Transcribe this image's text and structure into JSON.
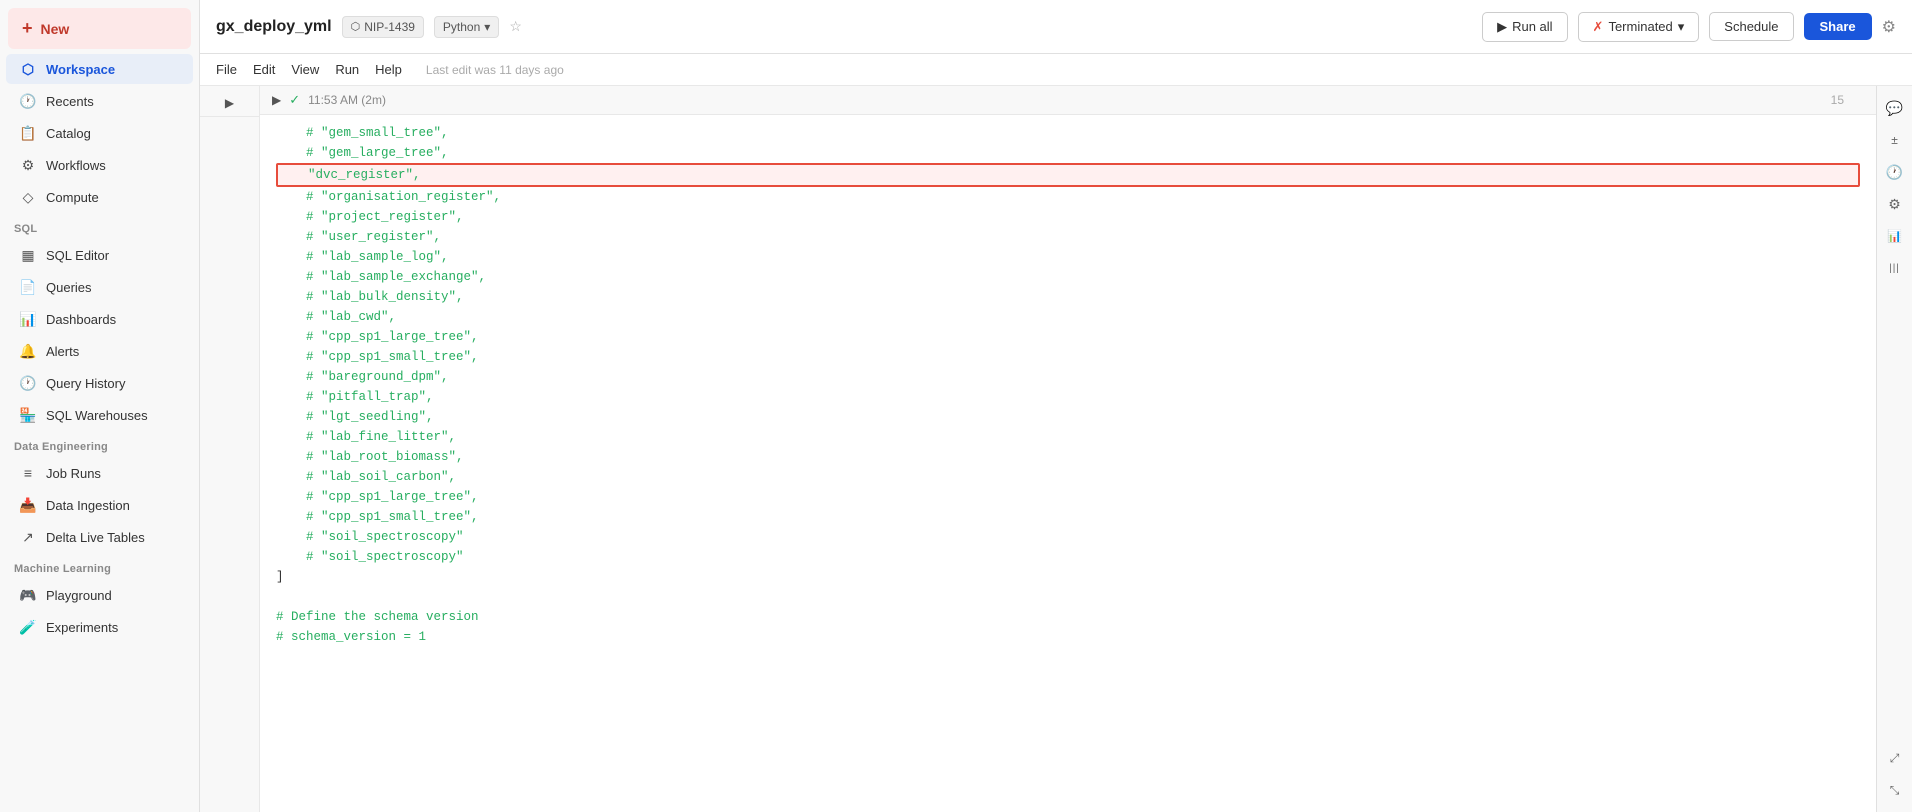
{
  "sidebar": {
    "new_label": "New",
    "items": [
      {
        "id": "workspace",
        "label": "Workspace",
        "icon": "🏠",
        "active": true,
        "section": null
      },
      {
        "id": "recents",
        "label": "Recents",
        "icon": "🕐",
        "active": false,
        "section": null
      },
      {
        "id": "catalog",
        "label": "Catalog",
        "icon": "📋",
        "active": false,
        "section": null
      },
      {
        "id": "workflows",
        "label": "Workflows",
        "icon": "⚙",
        "active": false,
        "section": null
      },
      {
        "id": "compute",
        "label": "Compute",
        "icon": "◇",
        "active": false,
        "section": null
      }
    ],
    "sql_section": "SQL",
    "sql_items": [
      {
        "id": "sql-editor",
        "label": "SQL Editor",
        "icon": "📝"
      },
      {
        "id": "queries",
        "label": "Queries",
        "icon": "📄"
      },
      {
        "id": "dashboards",
        "label": "Dashboards",
        "icon": "📊"
      },
      {
        "id": "alerts",
        "label": "Alerts",
        "icon": "🔔"
      },
      {
        "id": "query-history",
        "label": "Query History",
        "icon": "🕐"
      },
      {
        "id": "sql-warehouses",
        "label": "SQL Warehouses",
        "icon": "🏪"
      }
    ],
    "data_eng_section": "Data Engineering",
    "data_eng_items": [
      {
        "id": "job-runs",
        "label": "Job Runs",
        "icon": "≡"
      },
      {
        "id": "data-ingestion",
        "label": "Data Ingestion",
        "icon": "📥"
      },
      {
        "id": "delta-live-tables",
        "label": "Delta Live Tables",
        "icon": "↗"
      }
    ],
    "ml_section": "Machine Learning",
    "ml_items": [
      {
        "id": "playground",
        "label": "Playground",
        "icon": "🎮"
      },
      {
        "id": "experiments",
        "label": "Experiments",
        "icon": "🧪"
      }
    ]
  },
  "header": {
    "title": "gx_deploy_yml",
    "cluster": "NIP-1439",
    "language": "Python",
    "star_icon": "☆",
    "run_all_label": "Run all",
    "terminated_label": "Terminated",
    "schedule_label": "Schedule",
    "share_label": "Share"
  },
  "menubar": {
    "items": [
      "File",
      "Edit",
      "View",
      "Run",
      "Help"
    ],
    "last_edit": "Last edit was 11 days ago"
  },
  "cell": {
    "timestamp": "11:53 AM (2m)",
    "line_number": "15"
  },
  "code_lines": [
    {
      "text": "    # \"gem_small_tree\",",
      "highlighted": false
    },
    {
      "text": "    # \"gem_large_tree\",",
      "highlighted": false
    },
    {
      "text": "    \"dvc_register\",",
      "highlighted": true
    },
    {
      "text": "    # \"organisation_register\",",
      "highlighted": false
    },
    {
      "text": "    # \"project_register\",",
      "highlighted": false
    },
    {
      "text": "    # \"user_register\",",
      "highlighted": false
    },
    {
      "text": "    # \"lab_sample_log\",",
      "highlighted": false
    },
    {
      "text": "    # \"lab_sample_exchange\",",
      "highlighted": false
    },
    {
      "text": "    # \"lab_bulk_density\",",
      "highlighted": false
    },
    {
      "text": "    # \"lab_cwd\",",
      "highlighted": false
    },
    {
      "text": "    # \"cpp_sp1_large_tree\",",
      "highlighted": false
    },
    {
      "text": "    # \"cpp_sp1_small_tree\",",
      "highlighted": false
    },
    {
      "text": "    # \"bareground_dpm\",",
      "highlighted": false
    },
    {
      "text": "    # \"pitfall_trap\",",
      "highlighted": false
    },
    {
      "text": "    # \"lgt_seedling\",",
      "highlighted": false
    },
    {
      "text": "    # \"lab_fine_litter\",",
      "highlighted": false
    },
    {
      "text": "    # \"lab_root_biomass\",",
      "highlighted": false
    },
    {
      "text": "    # \"lab_soil_carbon\",",
      "highlighted": false
    },
    {
      "text": "    # \"cpp_sp1_large_tree\",",
      "highlighted": false
    },
    {
      "text": "    # \"cpp_sp1_small_tree\",",
      "highlighted": false
    },
    {
      "text": "    # \"soil_spectroscopy\"",
      "highlighted": false
    },
    {
      "text": "    # \"soil_spectroscopy\"",
      "highlighted": false
    },
    {
      "text": "]",
      "highlighted": false
    },
    {
      "text": "",
      "highlighted": false
    },
    {
      "text": "# Define the schema version",
      "highlighted": false
    },
    {
      "text": "# schema_version = 1",
      "highlighted": false
    }
  ],
  "right_sidebar": {
    "icons": [
      {
        "id": "chat-icon",
        "symbol": "💬"
      },
      {
        "id": "diff-icon",
        "symbol": "±"
      },
      {
        "id": "history-icon",
        "symbol": "🕐"
      },
      {
        "id": "settings-icon",
        "symbol": "⚙"
      },
      {
        "id": "chart-icon",
        "symbol": "📊"
      },
      {
        "id": "columns-icon",
        "symbol": "|||"
      },
      {
        "id": "expand-icon",
        "symbol": "⤢"
      },
      {
        "id": "collapse-icon",
        "symbol": "⤡"
      }
    ]
  }
}
